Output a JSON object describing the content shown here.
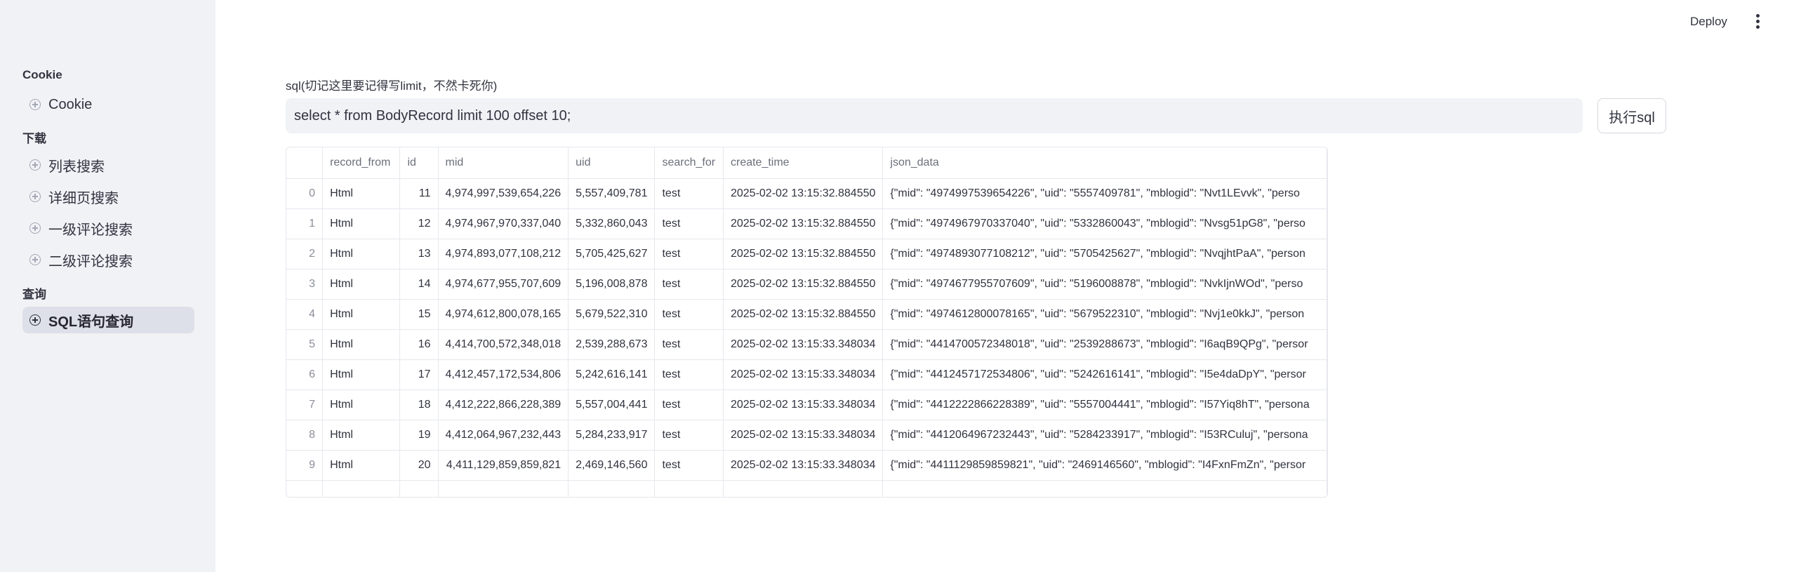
{
  "header": {
    "deploy_label": "Deploy"
  },
  "sidebar": {
    "sections": [
      {
        "heading": "Cookie"
      },
      {
        "heading": "下载"
      },
      {
        "heading": "查询"
      }
    ],
    "items": [
      {
        "label": "Cookie"
      },
      {
        "label": "列表搜索"
      },
      {
        "label": "详细页搜索"
      },
      {
        "label": "一级评论搜索"
      },
      {
        "label": "二级评论搜索"
      },
      {
        "label": "SQL语句查询"
      }
    ]
  },
  "main": {
    "sql_label": "sql(切记这里要记得写limit，不然卡死你)",
    "sql_value": "select * from BodyRecord limit 100 offset 10;",
    "exec_button": "执行sql"
  },
  "table": {
    "columns": [
      "",
      "record_from",
      "id",
      "mid",
      "uid",
      "search_for",
      "create_time",
      "json_data"
    ],
    "rows": [
      [
        "0",
        "Html",
        "11",
        "4,974,997,539,654,226",
        "5,557,409,781",
        "test",
        "2025-02-02 13:15:32.884550",
        "{\"mid\": \"4974997539654226\", \"uid\": \"5557409781\", \"mblogid\": \"Nvt1LEvvk\", \"perso"
      ],
      [
        "1",
        "Html",
        "12",
        "4,974,967,970,337,040",
        "5,332,860,043",
        "test",
        "2025-02-02 13:15:32.884550",
        "{\"mid\": \"4974967970337040\", \"uid\": \"5332860043\", \"mblogid\": \"Nvsg51pG8\", \"perso"
      ],
      [
        "2",
        "Html",
        "13",
        "4,974,893,077,108,212",
        "5,705,425,627",
        "test",
        "2025-02-02 13:15:32.884550",
        "{\"mid\": \"4974893077108212\", \"uid\": \"5705425627\", \"mblogid\": \"NvqjhtPaA\", \"person"
      ],
      [
        "3",
        "Html",
        "14",
        "4,974,677,955,707,609",
        "5,196,008,878",
        "test",
        "2025-02-02 13:15:32.884550",
        "{\"mid\": \"4974677955707609\", \"uid\": \"5196008878\", \"mblogid\": \"NvkIjnWOd\", \"perso"
      ],
      [
        "4",
        "Html",
        "15",
        "4,974,612,800,078,165",
        "5,679,522,310",
        "test",
        "2025-02-02 13:15:32.884550",
        "{\"mid\": \"4974612800078165\", \"uid\": \"5679522310\", \"mblogid\": \"Nvj1e0kkJ\", \"person"
      ],
      [
        "5",
        "Html",
        "16",
        "4,414,700,572,348,018",
        "2,539,288,673",
        "test",
        "2025-02-02 13:15:33.348034",
        "{\"mid\": \"4414700572348018\", \"uid\": \"2539288673\", \"mblogid\": \"I6aqB9QPg\", \"persor"
      ],
      [
        "6",
        "Html",
        "17",
        "4,412,457,172,534,806",
        "5,242,616,141",
        "test",
        "2025-02-02 13:15:33.348034",
        "{\"mid\": \"4412457172534806\", \"uid\": \"5242616141\", \"mblogid\": \"I5e4daDpY\", \"persor"
      ],
      [
        "7",
        "Html",
        "18",
        "4,412,222,866,228,389",
        "5,557,004,441",
        "test",
        "2025-02-02 13:15:33.348034",
        "{\"mid\": \"4412222866228389\", \"uid\": \"5557004441\", \"mblogid\": \"I57Yiq8hT\", \"persona"
      ],
      [
        "8",
        "Html",
        "19",
        "4,412,064,967,232,443",
        "5,284,233,917",
        "test",
        "2025-02-02 13:15:33.348034",
        "{\"mid\": \"4412064967232443\", \"uid\": \"5284233917\", \"mblogid\": \"I53RCuluj\", \"persona"
      ],
      [
        "9",
        "Html",
        "20",
        "4,411,129,859,859,821",
        "2,469,146,560",
        "test",
        "2025-02-02 13:15:33.348034",
        "{\"mid\": \"4411129859859821\", \"uid\": \"2469146560\", \"mblogid\": \"I4FxnFmZn\", \"persor"
      ]
    ]
  }
}
